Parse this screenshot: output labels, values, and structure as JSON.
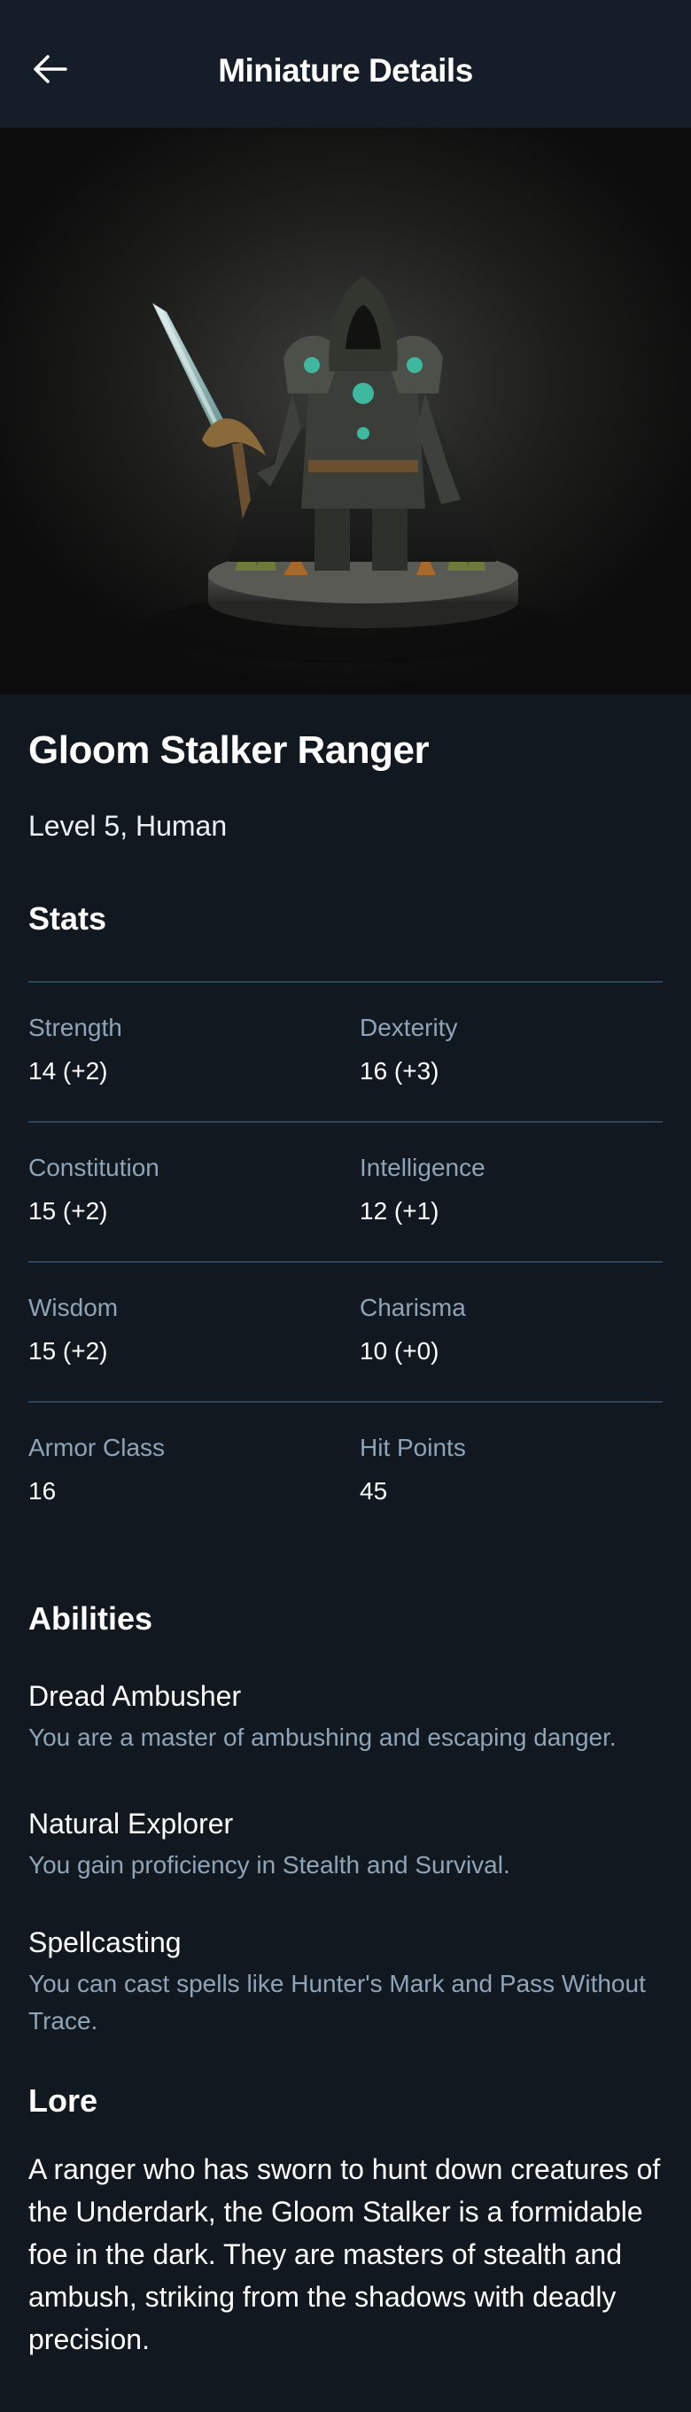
{
  "header": {
    "title": "Miniature Details",
    "back_icon": "arrow-left-icon"
  },
  "hero": {
    "image_icon": "hooded-ranger-miniature-figure"
  },
  "character": {
    "name": "Gloom Stalker Ranger",
    "subtitle": "Level 5, Human"
  },
  "stats": {
    "title": "Stats",
    "items": [
      {
        "label": "Strength",
        "value": "14 (+2)"
      },
      {
        "label": "Dexterity",
        "value": "16 (+3)"
      },
      {
        "label": "Constitution",
        "value": "15 (+2)"
      },
      {
        "label": "Intelligence",
        "value": "12 (+1)"
      },
      {
        "label": "Wisdom",
        "value": "15 (+2)"
      },
      {
        "label": "Charisma",
        "value": "10 (+0)"
      },
      {
        "label": "Armor Class",
        "value": "16"
      },
      {
        "label": "Hit Points",
        "value": "45"
      }
    ]
  },
  "abilities": {
    "title": "Abilities",
    "items": [
      {
        "name": "Dread Ambusher",
        "description": "You are a master of ambushing and escaping danger."
      },
      {
        "name": "Natural Explorer",
        "description": "You gain proficiency in Stealth and Survival."
      },
      {
        "name": "Spellcasting",
        "description": "You can cast spells like Hunter's Mark and Pass Without Trace."
      }
    ]
  },
  "lore": {
    "title": "Lore",
    "text": "A ranger who has sworn to hunt down creatures of the Underdark, the Gloom Stalker is a formidable foe in the dark. They are masters of stealth and ambush, striking from the shadows with deadly precision."
  },
  "colors": {
    "background": "#111820",
    "header": "#151e28",
    "muted_text": "#8fa4b8",
    "divider": "#2e4458",
    "accent_gem": "#3fb8a0"
  }
}
